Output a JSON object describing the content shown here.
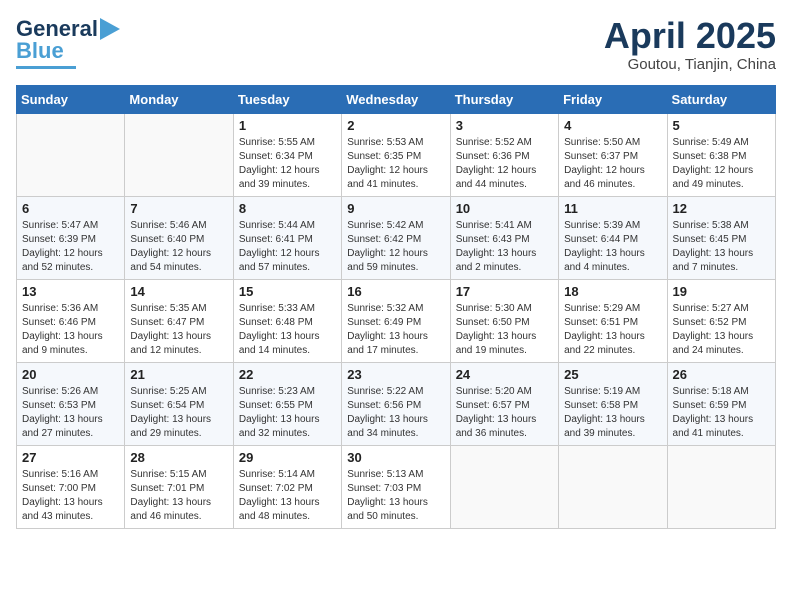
{
  "header": {
    "logo_general": "General",
    "logo_blue": "Blue",
    "month_title": "April 2025",
    "location": "Goutou, Tianjin, China"
  },
  "weekdays": [
    "Sunday",
    "Monday",
    "Tuesday",
    "Wednesday",
    "Thursday",
    "Friday",
    "Saturday"
  ],
  "weeks": [
    [
      {
        "day": "",
        "info": ""
      },
      {
        "day": "",
        "info": ""
      },
      {
        "day": "1",
        "sunrise": "Sunrise: 5:55 AM",
        "sunset": "Sunset: 6:34 PM",
        "daylight": "Daylight: 12 hours and 39 minutes."
      },
      {
        "day": "2",
        "sunrise": "Sunrise: 5:53 AM",
        "sunset": "Sunset: 6:35 PM",
        "daylight": "Daylight: 12 hours and 41 minutes."
      },
      {
        "day": "3",
        "sunrise": "Sunrise: 5:52 AM",
        "sunset": "Sunset: 6:36 PM",
        "daylight": "Daylight: 12 hours and 44 minutes."
      },
      {
        "day": "4",
        "sunrise": "Sunrise: 5:50 AM",
        "sunset": "Sunset: 6:37 PM",
        "daylight": "Daylight: 12 hours and 46 minutes."
      },
      {
        "day": "5",
        "sunrise": "Sunrise: 5:49 AM",
        "sunset": "Sunset: 6:38 PM",
        "daylight": "Daylight: 12 hours and 49 minutes."
      }
    ],
    [
      {
        "day": "6",
        "sunrise": "Sunrise: 5:47 AM",
        "sunset": "Sunset: 6:39 PM",
        "daylight": "Daylight: 12 hours and 52 minutes."
      },
      {
        "day": "7",
        "sunrise": "Sunrise: 5:46 AM",
        "sunset": "Sunset: 6:40 PM",
        "daylight": "Daylight: 12 hours and 54 minutes."
      },
      {
        "day": "8",
        "sunrise": "Sunrise: 5:44 AM",
        "sunset": "Sunset: 6:41 PM",
        "daylight": "Daylight: 12 hours and 57 minutes."
      },
      {
        "day": "9",
        "sunrise": "Sunrise: 5:42 AM",
        "sunset": "Sunset: 6:42 PM",
        "daylight": "Daylight: 12 hours and 59 minutes."
      },
      {
        "day": "10",
        "sunrise": "Sunrise: 5:41 AM",
        "sunset": "Sunset: 6:43 PM",
        "daylight": "Daylight: 13 hours and 2 minutes."
      },
      {
        "day": "11",
        "sunrise": "Sunrise: 5:39 AM",
        "sunset": "Sunset: 6:44 PM",
        "daylight": "Daylight: 13 hours and 4 minutes."
      },
      {
        "day": "12",
        "sunrise": "Sunrise: 5:38 AM",
        "sunset": "Sunset: 6:45 PM",
        "daylight": "Daylight: 13 hours and 7 minutes."
      }
    ],
    [
      {
        "day": "13",
        "sunrise": "Sunrise: 5:36 AM",
        "sunset": "Sunset: 6:46 PM",
        "daylight": "Daylight: 13 hours and 9 minutes."
      },
      {
        "day": "14",
        "sunrise": "Sunrise: 5:35 AM",
        "sunset": "Sunset: 6:47 PM",
        "daylight": "Daylight: 13 hours and 12 minutes."
      },
      {
        "day": "15",
        "sunrise": "Sunrise: 5:33 AM",
        "sunset": "Sunset: 6:48 PM",
        "daylight": "Daylight: 13 hours and 14 minutes."
      },
      {
        "day": "16",
        "sunrise": "Sunrise: 5:32 AM",
        "sunset": "Sunset: 6:49 PM",
        "daylight": "Daylight: 13 hours and 17 minutes."
      },
      {
        "day": "17",
        "sunrise": "Sunrise: 5:30 AM",
        "sunset": "Sunset: 6:50 PM",
        "daylight": "Daylight: 13 hours and 19 minutes."
      },
      {
        "day": "18",
        "sunrise": "Sunrise: 5:29 AM",
        "sunset": "Sunset: 6:51 PM",
        "daylight": "Daylight: 13 hours and 22 minutes."
      },
      {
        "day": "19",
        "sunrise": "Sunrise: 5:27 AM",
        "sunset": "Sunset: 6:52 PM",
        "daylight": "Daylight: 13 hours and 24 minutes."
      }
    ],
    [
      {
        "day": "20",
        "sunrise": "Sunrise: 5:26 AM",
        "sunset": "Sunset: 6:53 PM",
        "daylight": "Daylight: 13 hours and 27 minutes."
      },
      {
        "day": "21",
        "sunrise": "Sunrise: 5:25 AM",
        "sunset": "Sunset: 6:54 PM",
        "daylight": "Daylight: 13 hours and 29 minutes."
      },
      {
        "day": "22",
        "sunrise": "Sunrise: 5:23 AM",
        "sunset": "Sunset: 6:55 PM",
        "daylight": "Daylight: 13 hours and 32 minutes."
      },
      {
        "day": "23",
        "sunrise": "Sunrise: 5:22 AM",
        "sunset": "Sunset: 6:56 PM",
        "daylight": "Daylight: 13 hours and 34 minutes."
      },
      {
        "day": "24",
        "sunrise": "Sunrise: 5:20 AM",
        "sunset": "Sunset: 6:57 PM",
        "daylight": "Daylight: 13 hours and 36 minutes."
      },
      {
        "day": "25",
        "sunrise": "Sunrise: 5:19 AM",
        "sunset": "Sunset: 6:58 PM",
        "daylight": "Daylight: 13 hours and 39 minutes."
      },
      {
        "day": "26",
        "sunrise": "Sunrise: 5:18 AM",
        "sunset": "Sunset: 6:59 PM",
        "daylight": "Daylight: 13 hours and 41 minutes."
      }
    ],
    [
      {
        "day": "27",
        "sunrise": "Sunrise: 5:16 AM",
        "sunset": "Sunset: 7:00 PM",
        "daylight": "Daylight: 13 hours and 43 minutes."
      },
      {
        "day": "28",
        "sunrise": "Sunrise: 5:15 AM",
        "sunset": "Sunset: 7:01 PM",
        "daylight": "Daylight: 13 hours and 46 minutes."
      },
      {
        "day": "29",
        "sunrise": "Sunrise: 5:14 AM",
        "sunset": "Sunset: 7:02 PM",
        "daylight": "Daylight: 13 hours and 48 minutes."
      },
      {
        "day": "30",
        "sunrise": "Sunrise: 5:13 AM",
        "sunset": "Sunset: 7:03 PM",
        "daylight": "Daylight: 13 hours and 50 minutes."
      },
      {
        "day": "",
        "info": ""
      },
      {
        "day": "",
        "info": ""
      },
      {
        "day": "",
        "info": ""
      }
    ]
  ]
}
